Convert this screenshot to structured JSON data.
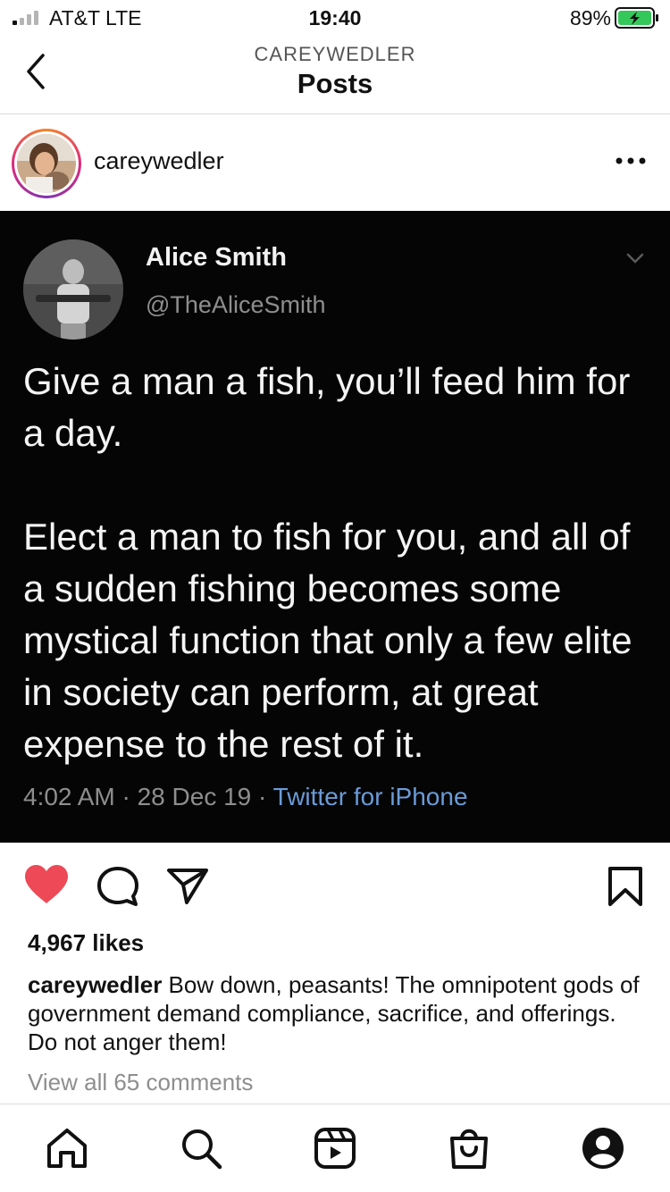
{
  "status_bar": {
    "carrier": "AT&T   LTE",
    "time": "19:40",
    "battery": "89%"
  },
  "header": {
    "account": "CAREYWEDLER",
    "title": "Posts"
  },
  "post": {
    "username": "careywedler",
    "tweet": {
      "name": "Alice Smith",
      "handle": "@TheAliceSmith",
      "paragraph_1": "Give a man a fish, you’ll feed him for a day.",
      "paragraph_2": "Elect a man to fish for you, and all of a sudden fishing becomes some mystical function that only a few elite in society can perform, at great expense to the rest of it.",
      "timestamp": "4:02 AM · 28 Dec 19 · ",
      "source": "Twitter for iPhone"
    },
    "likes": "4,967 likes",
    "caption_user": "careywedler",
    "caption_text": " Bow down, peasants! The omnipotent gods of government demand compliance, sacrifice, and offerings. Do not anger them!",
    "view_comments": "View all 65 comments",
    "liked": true
  },
  "colors": {
    "like_red": "#ed4956",
    "battery_green": "#34c759",
    "tweet_link_blue": "#6a9bd8"
  },
  "icons": {
    "status": [
      "signal-icon",
      "battery-icon"
    ],
    "header": [
      "back-chevron-icon"
    ],
    "post": [
      "more-dots-icon",
      "heart-filled-icon",
      "comment-icon",
      "share-icon",
      "bookmark-icon"
    ],
    "tabs": [
      "home-icon",
      "search-icon",
      "reels-icon",
      "shop-icon",
      "profile-icon"
    ]
  }
}
